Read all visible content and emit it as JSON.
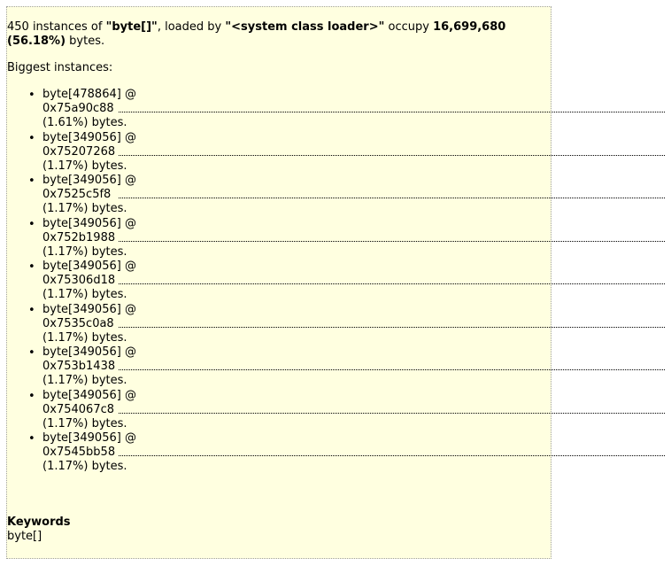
{
  "summary": {
    "count_text": "450 instances of ",
    "class_name": "\"byte[]\"",
    "loaded_by_text": ", loaded by ",
    "loader_name": "\"<system class loader>\"",
    "occupy_text": " occupy ",
    "size": "16,699,680",
    "percent": "(56.18%)",
    "bytes_text": " bytes."
  },
  "biggest_label": "Biggest instances:",
  "instances": [
    {
      "name": "byte[478864] @",
      "address": "0x75a90c88",
      "share": "(1.61%) bytes."
    },
    {
      "name": "byte[349056] @",
      "address": "0x75207268",
      "share": "(1.17%) bytes."
    },
    {
      "name": "byte[349056] @",
      "address": "0x7525c5f8",
      "share": "(1.17%) bytes."
    },
    {
      "name": "byte[349056] @",
      "address": "0x752b1988",
      "share": "(1.17%) bytes."
    },
    {
      "name": "byte[349056] @",
      "address": "0x75306d18",
      "share": "(1.17%) bytes."
    },
    {
      "name": "byte[349056] @",
      "address": "0x7535c0a8",
      "share": "(1.17%) bytes."
    },
    {
      "name": "byte[349056] @",
      "address": "0x753b1438",
      "share": "(1.17%) bytes."
    },
    {
      "name": "byte[349056] @",
      "address": "0x754067c8",
      "share": "(1.17%) bytes."
    },
    {
      "name": "byte[349056] @",
      "address": "0x7545bb58",
      "share": "(1.17%) bytes."
    }
  ],
  "keywords": {
    "title": "Keywords",
    "value": "byte[]"
  }
}
